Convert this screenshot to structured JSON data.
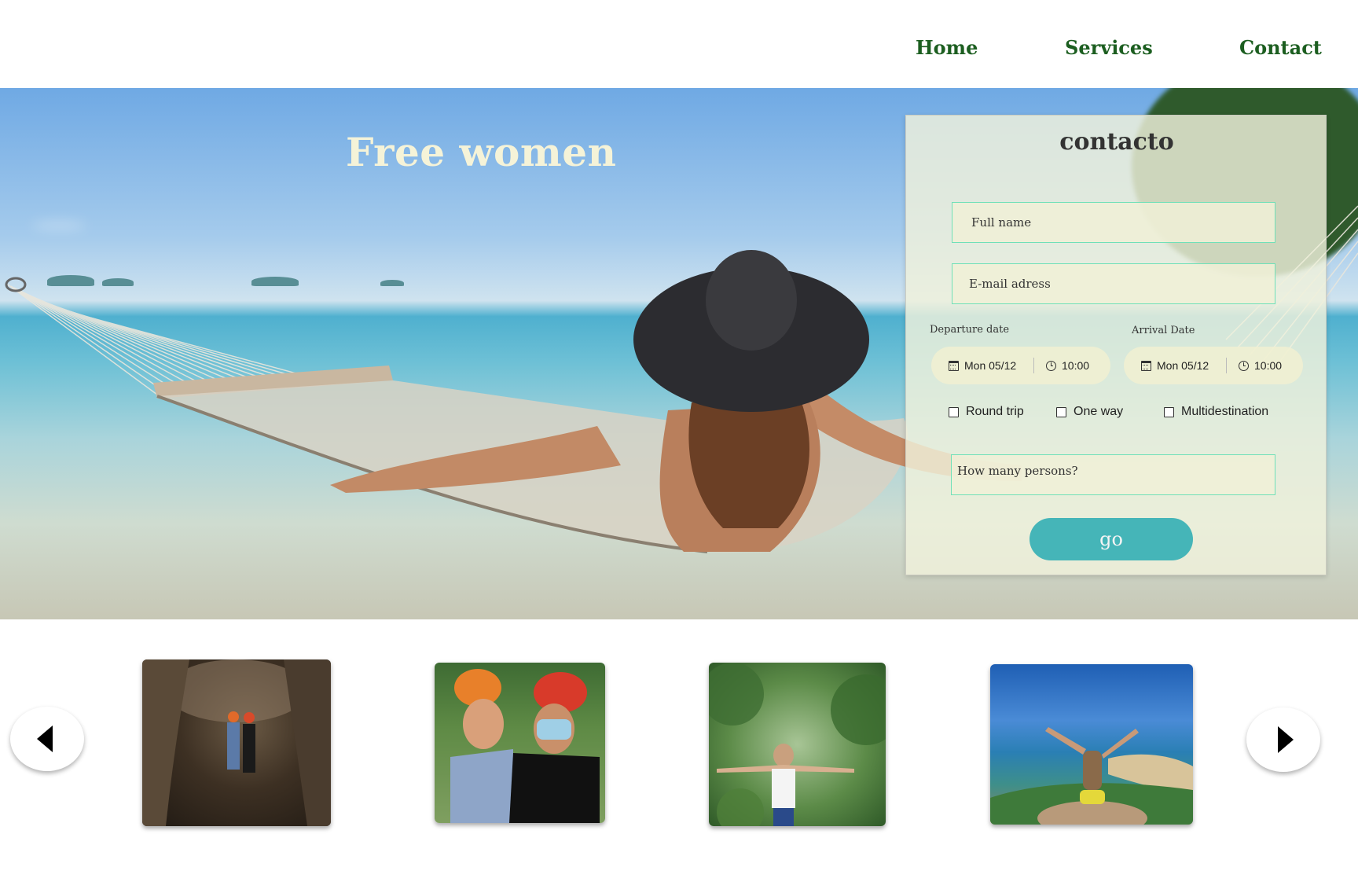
{
  "nav": {
    "home": "Home",
    "services": "Services",
    "contact": "Contact"
  },
  "hero": {
    "title": "Free women"
  },
  "contact_form": {
    "title": "contacto",
    "full_name_placeholder": "Full name",
    "email_placeholder": "E-mail adress",
    "departure_label": "Departure date",
    "arrival_label": "Arrival Date",
    "departure_date": "Mon 05/12",
    "departure_time": "10:00",
    "arrival_date": "Mon 05/12",
    "arrival_time": "10:00",
    "options": [
      "Round trip",
      "One way",
      "Multidestination"
    ],
    "persons_placeholder": "How many persons?",
    "submit_label": "go"
  },
  "gallery": {
    "prev_icon": "caret-left-icon",
    "next_icon": "caret-right-icon"
  },
  "colors": {
    "nav_text": "#1c5e20",
    "hero_title": "#f5f3d8",
    "field_border": "#6fe0b8",
    "go_button": "#45b5b8"
  }
}
